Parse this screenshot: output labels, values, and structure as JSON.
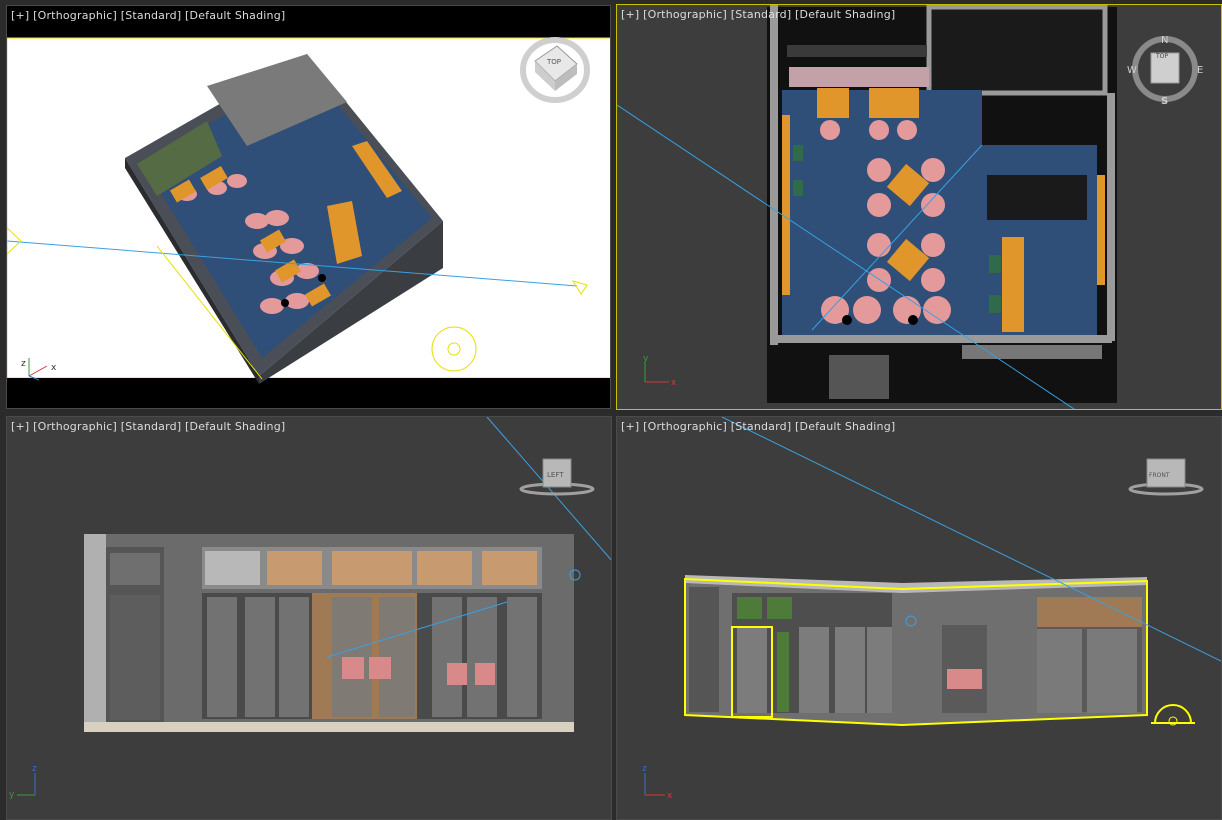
{
  "viewports": [
    {
      "plus": "[+]",
      "view": "[Orthographic]",
      "renderer": "[Standard]",
      "shading": "[Default Shading]"
    },
    {
      "plus": "[+]",
      "view": "[Orthographic]",
      "renderer": "[Standard]",
      "shading": "[Default Shading]"
    },
    {
      "plus": "[+]",
      "view": "[Orthographic]",
      "renderer": "[Standard]",
      "shading": "[Default Shading]"
    },
    {
      "plus": "[+]",
      "view": "[Orthographic]",
      "renderer": "[Standard]",
      "shading": "[Default Shading]"
    }
  ],
  "viewcube": {
    "top_label": "TOP",
    "left_label": "LEFT",
    "front_label": "FRONT",
    "compass": {
      "n": "N",
      "s": "S",
      "e": "E",
      "w": "W"
    }
  },
  "axes": {
    "x": "x",
    "y": "y",
    "z": "z"
  },
  "colors": {
    "viewport_bg": "#3d3d3d",
    "active_border": "#c9c000",
    "selection": "#ffff00",
    "light_line": "#3aa0e0",
    "floor_blue": "#2f4f78",
    "chair_pink": "#e49a9a",
    "table_wood": "#e0962a"
  }
}
